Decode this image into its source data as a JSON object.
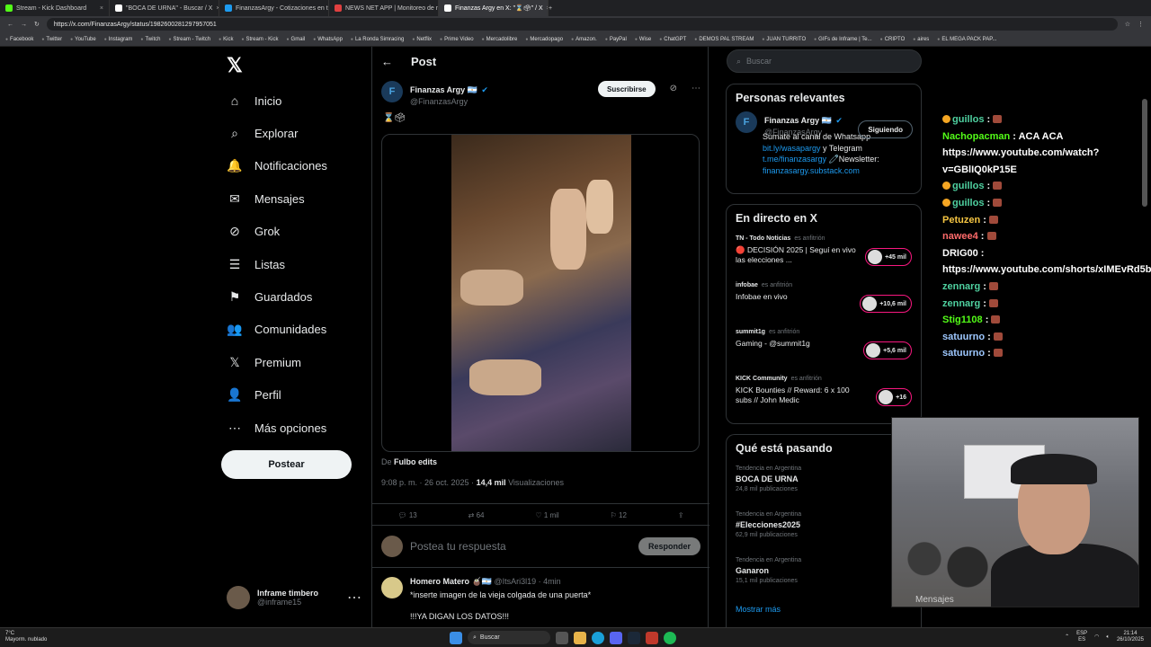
{
  "browser": {
    "tabs": [
      {
        "title": "Stream - Kick Dashboard",
        "color": "#53fc18"
      },
      {
        "title": "\"BOCA DE URNA\" - Buscar / X",
        "color": "#ffffff"
      },
      {
        "title": "FinanzasArgy - Cotizaciones en ti...",
        "color": "#1d9bf0"
      },
      {
        "title": "NEWS NET APP | Monitoreo de n...",
        "color": "#e04040"
      },
      {
        "title": "Finanzas Argy en X: \"⌛🗳\" / X",
        "color": "#ffffff"
      }
    ],
    "url": "https://x.com/FinanzasArgy/status/1982600281297957051",
    "bookmarks": [
      "Facebook",
      "Twitter",
      "YouTube",
      "Instagram",
      "Twitch",
      "Stream - Twitch",
      "Kick",
      "Stream - Kick",
      "Gmail",
      "WhatsApp",
      "La Ronda Simracing",
      "Netflix",
      "Prime Video",
      "Mercadolibre",
      "Mercadopago",
      "Amazon.",
      "PayPal",
      "Wise",
      "ChatGPT",
      "DEMOS PAL STREAM",
      "JUAN TURRITO",
      "GIFs de Inframe | Te...",
      "CRIPTO",
      "aires",
      "EL MEGA PACK PAP..."
    ]
  },
  "nav": {
    "items": [
      {
        "label": "Inicio",
        "icon": "home-icon",
        "glyph": "⌂"
      },
      {
        "label": "Explorar",
        "icon": "search-icon",
        "glyph": "⌕"
      },
      {
        "label": "Notificaciones",
        "icon": "bell-icon",
        "glyph": "🔔"
      },
      {
        "label": "Mensajes",
        "icon": "mail-icon",
        "glyph": "✉"
      },
      {
        "label": "Grok",
        "icon": "grok-icon",
        "glyph": "⊘"
      },
      {
        "label": "Listas",
        "icon": "list-icon",
        "glyph": "☰"
      },
      {
        "label": "Guardados",
        "icon": "bookmark-icon",
        "glyph": "⚑"
      },
      {
        "label": "Comunidades",
        "icon": "communities-icon",
        "glyph": "👥"
      },
      {
        "label": "Premium",
        "icon": "x-premium-icon",
        "glyph": "𝕏"
      },
      {
        "label": "Perfil",
        "icon": "profile-icon",
        "glyph": "👤"
      },
      {
        "label": "Más opciones",
        "icon": "more-options-icon",
        "glyph": "⋯"
      }
    ],
    "post_button": "Postear",
    "profile": {
      "name": "Inframe timbero",
      "handle": "@inframe15"
    }
  },
  "post": {
    "header": "Post",
    "author_name": "Finanzas Argy 🇦🇷",
    "author_handle": "@FinanzasArgy",
    "subscribe": "Suscribirse",
    "text": "⌛🗳",
    "via_prefix": "De",
    "via_source": "Fulbo edits",
    "time": "9:08 p. m. · 26 oct. 2025 · ",
    "views_count": "14,4 mil",
    "views_label": " Visualizaciones",
    "stats": {
      "replies": "13",
      "reposts": "64",
      "likes": "1 mil",
      "bookmarks": "12"
    },
    "reply_placeholder": "Postea tu respuesta",
    "reply_button": "Responder"
  },
  "comment": {
    "name": "Homero Matero 🧉🇦🇷",
    "handle": "@ItsAri3l19",
    "time": "· 4min",
    "text": "*inserte imagen de la vieja colgada de una puerta*",
    "text2": "!!!YA DIGAN LOS DATOS!!!"
  },
  "sidebar": {
    "search_placeholder": "Buscar",
    "relevant_title": "Personas relevantes",
    "relevant": {
      "name": "Finanzas Argy 🇦🇷",
      "handle": "@FinanzasArgy",
      "follow": "Siguiendo",
      "bio1": "Sumate al canal de Whatsapp",
      "bio_link1": "bit.ly/wasapargy",
      "bio2": " y Telegram",
      "bio_link2": "t.me/finanzasargy",
      "bio3": " 🧷Newsletter:",
      "bio_link3": "finanzasargy.substack.com"
    },
    "live_title": "En directo en X",
    "live": [
      {
        "host": "TN - Todo Noticias",
        "suffix": "es anfitrión",
        "title": "🔴 DECISIÓN 2025 | Seguí en vivo las elecciones ...",
        "count": "+45 mil"
      },
      {
        "host": "infobae",
        "suffix": "es anfitrión",
        "title": "Infobae en vivo",
        "count": "+10,6 mil"
      },
      {
        "host": "summit1g",
        "suffix": "es anfitrión",
        "title": "Gaming - @summit1g",
        "count": "+5,6 mil"
      },
      {
        "host": "KICK Community",
        "suffix": "es anfitrión",
        "title": "KICK Bounties // Reward: 6 x 100 subs // John Medic",
        "count": "+16"
      }
    ],
    "trends_title": "Qué está pasando",
    "trends": [
      {
        "category": "Tendencia en Argentina",
        "title": "BOCA DE URNA",
        "posts": "24,8 mil publicaciones"
      },
      {
        "category": "Tendencia en Argentina",
        "title": "#Elecciones2025",
        "posts": "62,9 mil publicaciones"
      },
      {
        "category": "Tendencia en Argentina",
        "title": "Ganaron",
        "posts": "15,1 mil publicaciones"
      }
    ],
    "show_more": "Mostrar más"
  },
  "chat": [
    {
      "user": "guillos",
      "color": "#4fd1a0",
      "msg": "",
      "badge": true
    },
    {
      "user": "Nachopacman",
      "color": "#53fc18",
      "msg": "ACA ACA https://www.youtube.com/watch?v=GBlIQ0kP15E",
      "badge": false
    },
    {
      "user": "guillos",
      "color": "#4fd1a0",
      "msg": "",
      "badge": true
    },
    {
      "user": "guillos",
      "color": "#4fd1a0",
      "msg": "",
      "badge": true
    },
    {
      "user": "Petuzen",
      "color": "#f5c542",
      "msg": "",
      "badge": false
    },
    {
      "user": "nawee4",
      "color": "#ff6b6b",
      "msg": "",
      "badge": false
    },
    {
      "user": "DRIG00",
      "color": "#ffffff",
      "msg": "https://www.youtube.com/shorts/xIMEvRd5bA4",
      "badge": false
    },
    {
      "user": "zennarg",
      "color": "#4fd1a0",
      "msg": "",
      "badge": false
    },
    {
      "user": "zennarg",
      "color": "#4fd1a0",
      "msg": "",
      "badge": false
    },
    {
      "user": "Stig1108",
      "color": "#53fc18",
      "msg": "",
      "badge": false
    },
    {
      "user": "satuurno",
      "color": "#9ec8ff",
      "msg": "",
      "badge": false
    },
    {
      "user": "satuurno",
      "color": "#9ec8ff",
      "msg": "",
      "badge": false
    }
  ],
  "webcam_label": "Mensajes",
  "taskbar": {
    "temp": "7°C",
    "weather": "Mayorm. nublado",
    "search": "Buscar",
    "lang": "ESP",
    "lang2": "ES",
    "time": "21:14",
    "date": "26/10/2025"
  }
}
